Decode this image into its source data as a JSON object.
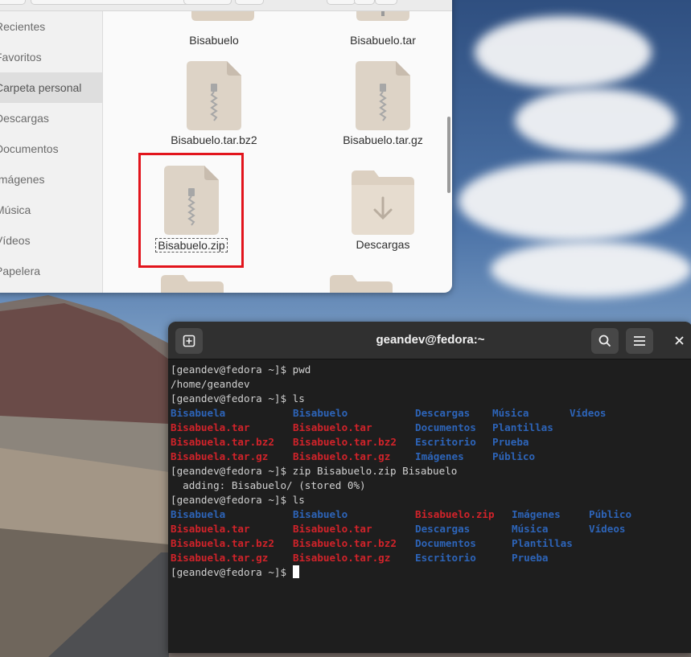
{
  "colors": {
    "terminal_bg": "#1e1e1e",
    "directory": "#2d64b8",
    "archive": "#d1232a",
    "selection": "#e2141c",
    "archive_icon": "#ddd3c6",
    "folder_icon": "#dcd0c1"
  },
  "files": {
    "sidebar": [
      {
        "label": "Recientes",
        "icon": "clock-icon"
      },
      {
        "label": "Favoritos",
        "icon": "star-icon"
      },
      {
        "label": "Carpeta personal",
        "icon": "home-icon",
        "active": true
      },
      {
        "label": "Descargas",
        "icon": "download-icon"
      },
      {
        "label": "Documentos",
        "icon": "document-icon"
      },
      {
        "label": "Imágenes",
        "icon": "image-icon"
      },
      {
        "label": "Música",
        "icon": "music-icon"
      },
      {
        "label": "Vídeos",
        "icon": "video-icon"
      },
      {
        "label": "Papelera",
        "icon": "trash-icon"
      }
    ],
    "items": {
      "bisabuelo": "Bisabuelo",
      "bisabuelo_tar": "Bisabuelo.tar",
      "bisabuelo_tar_bz2": "Bisabuelo.tar.bz2",
      "bisabuelo_tar_gz": "Bisabuelo.tar.gz",
      "bisabuelo_zip": "Bisabuelo.zip",
      "descargas": "Descargas"
    },
    "selected_item": "Bisabuelo.zip"
  },
  "terminal": {
    "title": "geandev@fedora:~",
    "prompt1": "[geandev@fedora ~]$ pwd",
    "output_pwd": "/home/geandev",
    "prompt2": "[geandev@fedora ~]$ ls",
    "ls1": [
      [
        "Bisabuela",
        "Bisabuelo",
        "Descargas",
        "Música",
        "Vídeos"
      ],
      [
        "Bisabuela.tar",
        "Bisabuelo.tar",
        "Documentos",
        "Plantillas",
        ""
      ],
      [
        "Bisabuela.tar.bz2",
        "Bisabuelo.tar.bz2",
        "Escritorio",
        "Prueba",
        ""
      ],
      [
        "Bisabuela.tar.gz",
        "Bisabuelo.tar.gz",
        "Imágenes",
        "Público",
        ""
      ]
    ],
    "prompt3": "[geandev@fedora ~]$ zip Bisabuelo.zip Bisabuelo",
    "output_zip": "  adding: Bisabuelo/ (stored 0%)",
    "prompt4": "[geandev@fedora ~]$ ls",
    "ls2": [
      [
        "Bisabuela",
        "Bisabuelo",
        "Bisabuelo.zip",
        "Imágenes",
        "Público"
      ],
      [
        "Bisabuela.tar",
        "Bisabuelo.tar",
        "Descargas",
        "Música",
        "Vídeos"
      ],
      [
        "Bisabuela.tar.bz2",
        "Bisabuelo.tar.bz2",
        "Documentos",
        "Plantillas",
        ""
      ],
      [
        "Bisabuela.tar.gz",
        "Bisabuelo.tar.gz",
        "Escritorio",
        "Prueba",
        ""
      ]
    ],
    "prompt5": "[geandev@fedora ~]$ "
  }
}
